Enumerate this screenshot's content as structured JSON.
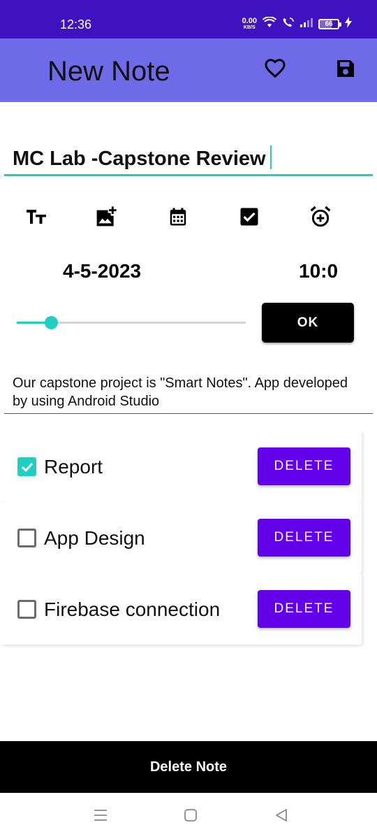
{
  "status_bar": {
    "time": "12:36",
    "net_speed_value": "0.00",
    "net_speed_unit": "KB/S",
    "battery_level": "66",
    "battery_fraction": 0.66
  },
  "app_bar": {
    "title": "New Note",
    "favorite_icon": "heart-outline-icon",
    "save_icon": "save-icon"
  },
  "note": {
    "title": "MC Lab -Capstone Review",
    "date": "4-5-2023",
    "time": "10:0",
    "body": "Our capstone project is \"Smart Notes\". App developed by using Android Studio"
  },
  "toolbar": {
    "icons": [
      "text-size-icon",
      "add-image-icon",
      "calendar-icon",
      "checkbox-icon",
      "alarm-add-icon"
    ]
  },
  "slider": {
    "value_fraction": 0.15
  },
  "ok_button": {
    "label": "OK"
  },
  "checklist": [
    {
      "label": "Report",
      "checked": true,
      "delete_label": "DELETE"
    },
    {
      "label": "App Design",
      "checked": false,
      "delete_label": "DELETE"
    },
    {
      "label": "Firebase connection",
      "checked": false,
      "delete_label": "DELETE"
    }
  ],
  "delete_note": {
    "label": "Delete Note"
  },
  "colors": {
    "status_bar": "#3f12c0",
    "app_bar": "#6f6ae8",
    "accent": "#1fcfc4",
    "delete_button": "#6200ea"
  },
  "nav_bar": {
    "icons": [
      "menu-icon",
      "home-icon",
      "back-icon"
    ]
  }
}
